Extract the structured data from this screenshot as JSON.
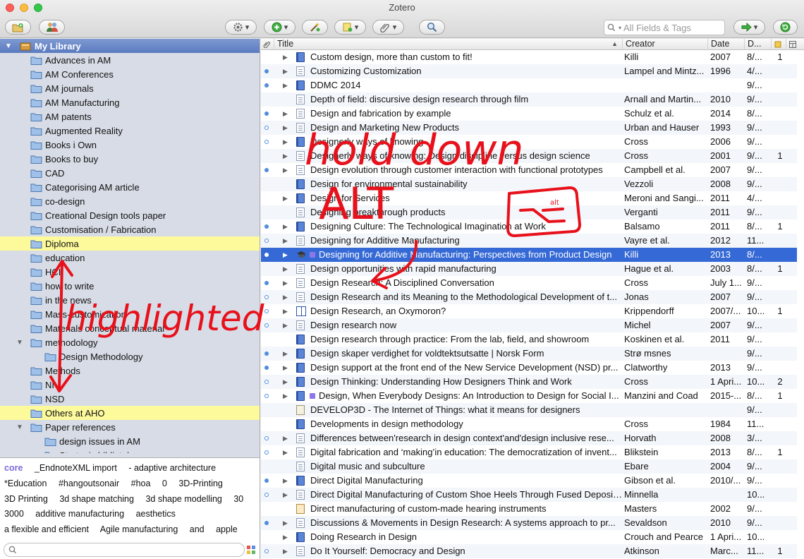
{
  "window": {
    "title": "Zotero"
  },
  "toolbar": {
    "search_placeholder": "All Fields & Tags"
  },
  "library": {
    "header": "My Library",
    "collections": [
      {
        "label": "Advances in AM",
        "level": 1
      },
      {
        "label": "AM Conferences",
        "level": 1
      },
      {
        "label": "AM journals",
        "level": 1
      },
      {
        "label": "AM Manufacturing",
        "level": 1
      },
      {
        "label": "AM patents",
        "level": 1
      },
      {
        "label": "Augmented Reality",
        "level": 1
      },
      {
        "label": "Books i Own",
        "level": 1
      },
      {
        "label": "Books to buy",
        "level": 1
      },
      {
        "label": "CAD",
        "level": 1
      },
      {
        "label": "Categorising AM article",
        "level": 1
      },
      {
        "label": "co-design",
        "level": 1
      },
      {
        "label": "Creational Design tools paper",
        "level": 1
      },
      {
        "label": "Customisation / Fabrication",
        "level": 1
      },
      {
        "label": "Diploma",
        "level": 1,
        "highlighted": true
      },
      {
        "label": "education",
        "level": 1
      },
      {
        "label": "HCI",
        "level": 1
      },
      {
        "label": "how to write",
        "level": 1
      },
      {
        "label": "in the news",
        "level": 1
      },
      {
        "label": "Mass-customization",
        "level": 1
      },
      {
        "label": "Materials conceptual material",
        "level": 1
      },
      {
        "label": "methodology",
        "level": 1,
        "expanded": true
      },
      {
        "label": "Design Methodology",
        "level": 2
      },
      {
        "label": "Methods",
        "level": 1
      },
      {
        "label": "NI",
        "level": 1
      },
      {
        "label": "NSD",
        "level": 1
      },
      {
        "label": "Others at AHO",
        "level": 1,
        "highlighted": true
      },
      {
        "label": "Paper references",
        "level": 1,
        "expanded": true
      },
      {
        "label": "design issues in AM",
        "level": 2
      },
      {
        "label": "Strategic bibliotek",
        "level": 2
      }
    ]
  },
  "tags": [
    "core",
    "_EndnoteXML import",
    "- adaptive architecture",
    "*Education",
    "#hangoutsonair",
    "#hoa",
    "0",
    "3D-Printing",
    "3D Printing",
    "3d shape matching",
    "3d shape modelling",
    "30",
    "3000",
    "additive manufacturing",
    "aesthetics",
    "a flexible and efficient",
    "Agile manufacturing",
    "and",
    "apple"
  ],
  "columns": {
    "title": "Title",
    "creator": "Creator",
    "date": "Date",
    "d": "D..."
  },
  "items": [
    {
      "title": "Custom design, more than custom to fit!",
      "creator": "Killi",
      "date": "2007",
      "d": "8/...",
      "n": "1",
      "icon": "book",
      "status": "none",
      "twisty": true
    },
    {
      "title": "Customizing Customization",
      "creator": "Lampel and Mintz...",
      "date": "1996",
      "d": "4/...",
      "n": "",
      "icon": "journal",
      "status": "full",
      "twisty": true
    },
    {
      "title": "DDMC 2014",
      "creator": "",
      "date": "",
      "d": "9/...",
      "n": "",
      "icon": "book",
      "status": "full",
      "twisty": true
    },
    {
      "title": "Depth of field: discursive design research through film",
      "creator": "Arnall and Martin...",
      "date": "2010",
      "d": "9/...",
      "n": "",
      "icon": "journal",
      "status": "none",
      "twisty": false
    },
    {
      "title": "Design and fabrication by example",
      "creator": "Schulz et al.",
      "date": "2014",
      "d": "8/...",
      "n": "",
      "icon": "journal",
      "status": "full",
      "twisty": true
    },
    {
      "title": "Design and Marketing New Products",
      "creator": "Urban and Hauser",
      "date": "1993",
      "d": "9/...",
      "n": "",
      "icon": "journal",
      "status": "ring",
      "twisty": true
    },
    {
      "title": "Designerly ways of knowing",
      "creator": "Cross",
      "date": "2006",
      "d": "9/...",
      "n": "",
      "icon": "book",
      "status": "ring",
      "twisty": true
    },
    {
      "title": "Designerly ways of knowing: Design discipline versus design science",
      "creator": "Cross",
      "date": "2001",
      "d": "9/...",
      "n": "1",
      "icon": "journal",
      "status": "none",
      "twisty": true
    },
    {
      "title": "Design evolution through customer interaction with functional prototypes",
      "creator": "Campbell et al.",
      "date": "2007",
      "d": "9/...",
      "n": "",
      "icon": "journal",
      "status": "full",
      "twisty": true
    },
    {
      "title": "Design for environmental sustainability",
      "creator": "Vezzoli",
      "date": "2008",
      "d": "9/...",
      "n": "",
      "icon": "book",
      "status": "none",
      "twisty": false
    },
    {
      "title": "Design for Services",
      "creator": "Meroni and Sangi...",
      "date": "2011",
      "d": "4/...",
      "n": "",
      "icon": "book",
      "status": "none",
      "twisty": true
    },
    {
      "title": "Designing breakthrough products",
      "creator": "Verganti",
      "date": "2011",
      "d": "9/...",
      "n": "",
      "icon": "journal",
      "status": "none",
      "twisty": false
    },
    {
      "title": "Designing Culture: The Technological Imagination at Work",
      "creator": "Balsamo",
      "date": "2011",
      "d": "8/...",
      "n": "1",
      "icon": "book",
      "status": "full",
      "twisty": true
    },
    {
      "title": "Designing for Additive Manufacturing",
      "creator": "Vayre et al.",
      "date": "2012",
      "d": "11...",
      "n": "",
      "icon": "journal",
      "status": "ring",
      "twisty": true
    },
    {
      "title": "Designing for Additive Manufacturing: Perspectives from Product Design",
      "creator": "Killi",
      "date": "2013",
      "d": "8/...",
      "n": "",
      "icon": "thesis",
      "status": "full",
      "twisty": true,
      "selected": true,
      "tagged": true
    },
    {
      "title": "Design opportunities with rapid manufacturing",
      "creator": "Hague et al.",
      "date": "2003",
      "d": "8/...",
      "n": "1",
      "icon": "journal",
      "status": "none",
      "twisty": true
    },
    {
      "title": "Design Research: A Disciplined Conversation",
      "creator": "Cross",
      "date": "July 1...",
      "d": "9/...",
      "n": "",
      "icon": "journal",
      "status": "full",
      "twisty": true
    },
    {
      "title": "Design Research and its Meaning to the Methodological Development of t...",
      "creator": "Jonas",
      "date": "2007",
      "d": "9/...",
      "n": "",
      "icon": "journal",
      "status": "ring",
      "twisty": true
    },
    {
      "title": "Design Research, an Oxymoron?",
      "creator": "Krippendorff",
      "date": "2007/...",
      "d": "10...",
      "n": "1",
      "icon": "openbook",
      "status": "ring",
      "twisty": true
    },
    {
      "title": "Design research now",
      "creator": "Michel",
      "date": "2007",
      "d": "9/...",
      "n": "",
      "icon": "journal",
      "status": "ring",
      "twisty": true
    },
    {
      "title": "Design research through practice: From the lab, field, and showroom",
      "creator": "Koskinen et al.",
      "date": "2011",
      "d": "9/...",
      "n": "",
      "icon": "book",
      "status": "none",
      "twisty": false
    },
    {
      "title": "Design skaper verdighet for voldtektsutsatte | Norsk Form",
      "creator": "Strø msnes",
      "date": "",
      "d": "9/...",
      "n": "",
      "icon": "book",
      "status": "full",
      "twisty": true
    },
    {
      "title": "Design support at the front end of the New Service Development (NSD) pr...",
      "creator": "Clatworthy",
      "date": "2013",
      "d": "9/...",
      "n": "",
      "icon": "book",
      "status": "full",
      "twisty": true
    },
    {
      "title": "Design Thinking: Understanding How Designers Think and Work",
      "creator": "Cross",
      "date": "1 Apri...",
      "d": "10...",
      "n": "2",
      "icon": "book",
      "status": "ring",
      "twisty": true
    },
    {
      "title": "Design, When Everybody Designs: An Introduction to Design for Social I...",
      "creator": "Manzini and Coad",
      "date": "2015-...",
      "d": "8/...",
      "n": "1",
      "icon": "book",
      "status": "ring",
      "twisty": true,
      "tagged": true
    },
    {
      "title": "DEVELOP3D - The Internet of Things: what it means for designers",
      "creator": "",
      "date": "",
      "d": "9/...",
      "n": "",
      "icon": "web",
      "status": "none",
      "twisty": false
    },
    {
      "title": "Developments in design methodology",
      "creator": "Cross",
      "date": "1984",
      "d": "11...",
      "n": "",
      "icon": "book",
      "status": "none",
      "twisty": false
    },
    {
      "title": "Differences between'research in design context'and'design inclusive rese...",
      "creator": "Horvath",
      "date": "2008",
      "d": "3/...",
      "n": "",
      "icon": "journal",
      "status": "ring",
      "twisty": true
    },
    {
      "title": "Digital fabrication and ‘making’in education: The democratization of invent...",
      "creator": "Blikstein",
      "date": "2013",
      "d": "8/...",
      "n": "1",
      "icon": "journal",
      "status": "ring",
      "twisty": true
    },
    {
      "title": "Digital music and subculture",
      "creator": "Ebare",
      "date": "2004",
      "d": "9/...",
      "n": "",
      "icon": "journal",
      "status": "none",
      "twisty": false
    },
    {
      "title": "Direct Digital Manufacturing",
      "creator": "Gibson et al.",
      "date": "2010/...",
      "d": "9/...",
      "n": "",
      "icon": "book",
      "status": "full",
      "twisty": true
    },
    {
      "title": "Direct Digital Manufacturing of Custom Shoe Heels Through Fused Deposition Mo...",
      "creator": "Minnella",
      "date": "",
      "d": "10...",
      "n": "",
      "icon": "journal",
      "status": "ring",
      "twisty": true
    },
    {
      "title": "Direct manufacturing of custom-made hearing instruments",
      "creator": "Masters",
      "date": "2002",
      "d": "9/...",
      "n": "",
      "icon": "audio",
      "status": "none",
      "twisty": false
    },
    {
      "title": "Discussions & Movements in Design Research: A systems approach to pr...",
      "creator": "Sevaldson",
      "date": "2010",
      "d": "9/...",
      "n": "",
      "icon": "journal",
      "status": "full",
      "twisty": true
    },
    {
      "title": "Doing Research in Design",
      "creator": "Crouch and Pearce",
      "date": "1 Apri...",
      "d": "10...",
      "n": "",
      "icon": "book",
      "status": "none",
      "twisty": true
    },
    {
      "title": "Do It Yourself: Democracy and Design",
      "creator": "Atkinson",
      "date": "Marc...",
      "d": "11...",
      "n": "1",
      "icon": "journal",
      "status": "ring",
      "twisty": true
    }
  ],
  "annotations": {
    "text1": "hold down",
    "text2": "ALT",
    "key_label": "alt",
    "text3": "highlighted",
    "ink_color": "#e8111b"
  },
  "colors": {
    "selection": "#3569d5",
    "highlight": "#fdfa9c",
    "sidebar": "#d7dce6",
    "library_header": "#5a7bc0"
  }
}
